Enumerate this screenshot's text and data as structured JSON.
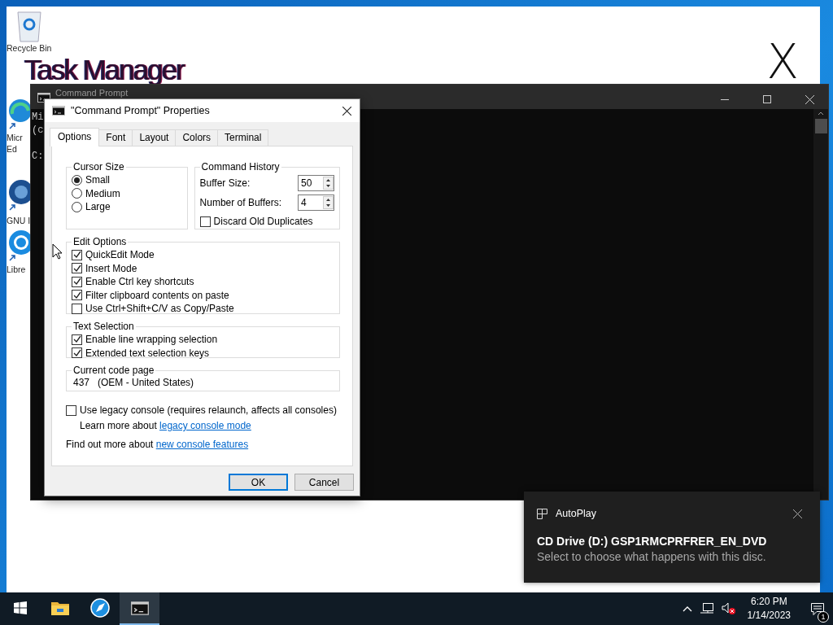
{
  "background_window": {
    "title": "Task Manager",
    "close": "X"
  },
  "desktop_icons": [
    {
      "kind": "recycle",
      "lines": [
        "Recycle Bin"
      ]
    },
    {
      "kind": "edge",
      "lines": [
        "Micr",
        "Ed"
      ]
    },
    {
      "kind": "gnu",
      "lines": [
        "GNU I"
      ]
    },
    {
      "kind": "libre",
      "lines": [
        "Libre"
      ]
    }
  ],
  "console_window": {
    "title": "Command Prompt",
    "lines": [
      {
        "text": "Mi",
        "gap_before": false
      },
      {
        "text": "(c",
        "gap_before": false
      },
      {
        "text": "C:",
        "gap_before": true
      }
    ]
  },
  "dialog": {
    "title": "\"Command Prompt\" Properties",
    "tabs": [
      {
        "label": "Options",
        "selected": true
      },
      {
        "label": "Font",
        "selected": false
      },
      {
        "label": "Layout",
        "selected": false
      },
      {
        "label": "Colors",
        "selected": false
      },
      {
        "label": "Terminal",
        "selected": false
      }
    ],
    "cursor_size": {
      "legend": "Cursor Size",
      "options": [
        {
          "label": "Small",
          "selected": true
        },
        {
          "label": "Medium",
          "selected": false
        },
        {
          "label": "Large",
          "selected": false
        }
      ]
    },
    "command_history": {
      "legend": "Command History",
      "fields": [
        {
          "label": "Buffer Size:",
          "value": "50"
        },
        {
          "label": "Number of Buffers:",
          "value": "4"
        }
      ],
      "discard": {
        "label": "Discard Old Duplicates",
        "checked": false
      }
    },
    "edit_options": {
      "legend": "Edit Options",
      "items": [
        {
          "label": "QuickEdit Mode",
          "checked": true
        },
        {
          "label": "Insert Mode",
          "checked": true
        },
        {
          "label": "Enable Ctrl key shortcuts",
          "checked": true
        },
        {
          "label": "Filter clipboard contents on paste",
          "checked": true
        },
        {
          "label": "Use Ctrl+Shift+C/V as Copy/Paste",
          "checked": false
        }
      ]
    },
    "text_selection": {
      "legend": "Text Selection",
      "items": [
        {
          "label": "Enable line wrapping selection",
          "checked": true
        },
        {
          "label": "Extended text selection keys",
          "checked": true
        }
      ]
    },
    "code_page": {
      "legend": "Current code page",
      "value": "437   (OEM - United States)"
    },
    "legacy": {
      "label": "Use legacy console (requires relaunch, affects all consoles)",
      "checked": false
    },
    "learn_more": {
      "text": "Learn more about",
      "link": "legacy console mode"
    },
    "find_out": {
      "text": "Find out more about",
      "link": "new console features"
    },
    "buttons": [
      {
        "label": "OK",
        "default": true
      },
      {
        "label": "Cancel",
        "default": false
      }
    ]
  },
  "autoplay": {
    "app": "AutoPlay",
    "title": "CD Drive (D:) GSP1RMCPRFRER_EN_DVD",
    "message": "Select to choose what happens with this disc."
  },
  "taskbar": {
    "apps": [
      {
        "kind": "start",
        "active": false
      },
      {
        "kind": "folder",
        "active": false
      },
      {
        "kind": "circle",
        "active": false
      },
      {
        "kind": "terminal",
        "active": true
      }
    ],
    "time": "6:20 PM",
    "date": "1/14/2023",
    "notification_count": "1"
  }
}
